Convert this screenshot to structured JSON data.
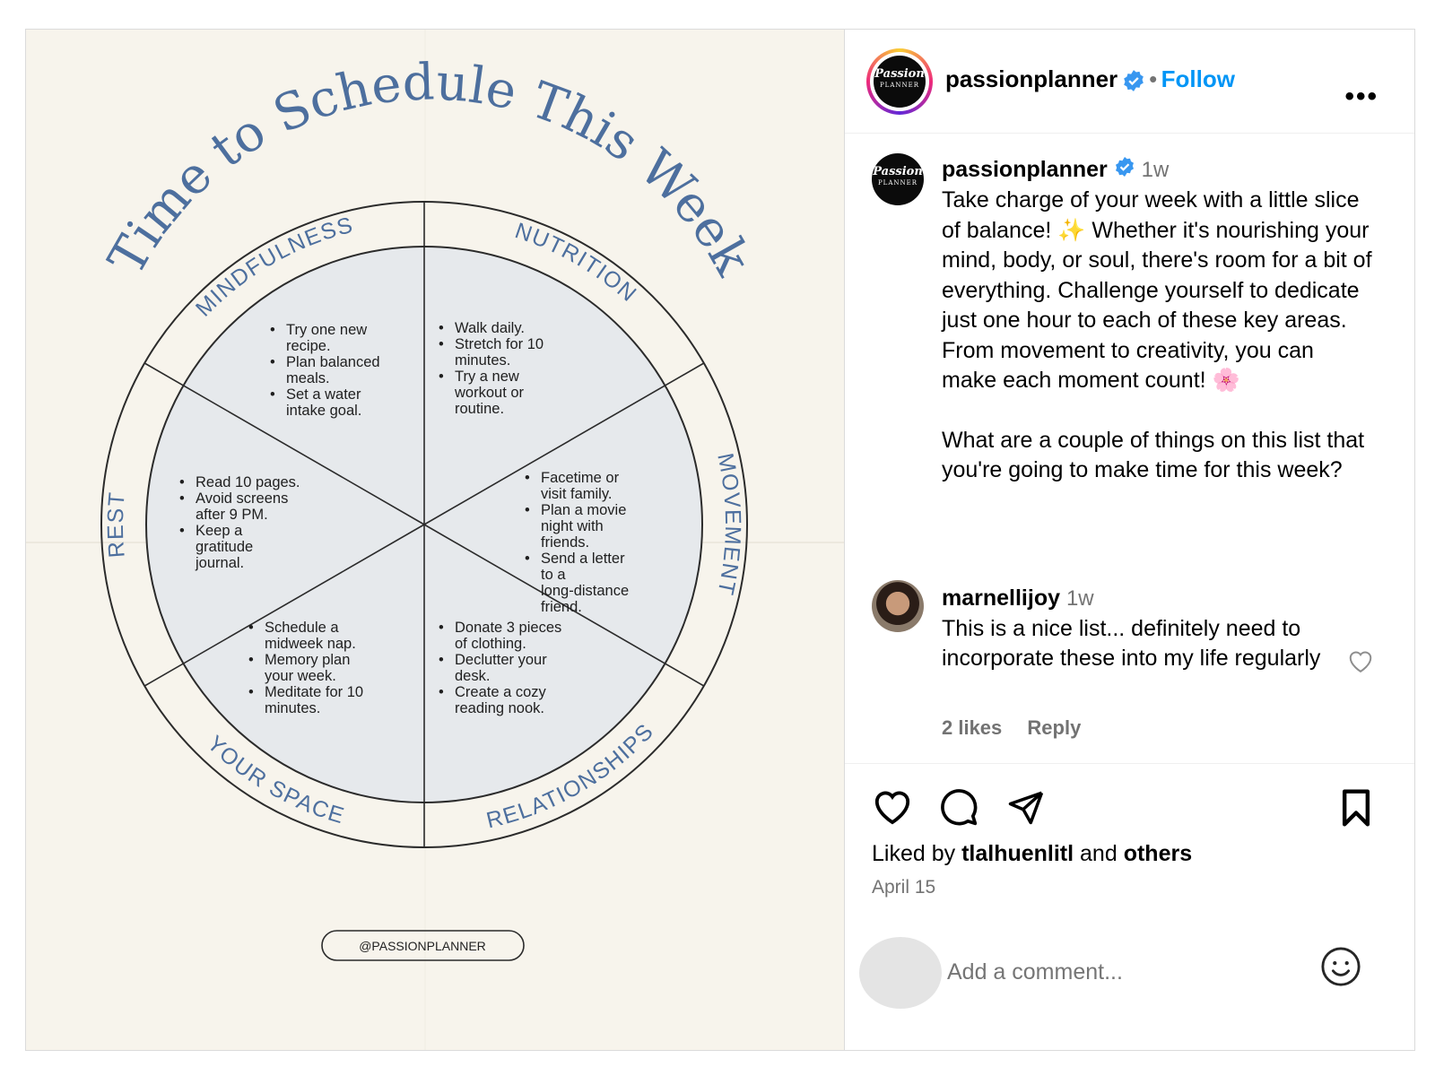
{
  "header": {
    "username": "passionplanner",
    "separator": "•",
    "follow_label": "Follow",
    "more_label": "•••",
    "avatar_logo": {
      "line1": "Passion",
      "line2": "PLANNER"
    }
  },
  "graphic": {
    "title": "Time to Schedule This Week",
    "segments": [
      {
        "label": "NUTRITION",
        "items": [
          "Try one new recipe.",
          "Plan balanced meals.",
          "Set a water intake goal."
        ]
      },
      {
        "label": "MOVEMENT",
        "items": [
          "Walk daily.",
          "Stretch for 10 minutes.",
          "Try a new workout or routine."
        ]
      },
      {
        "label": "RELATIONSHIPS",
        "items": [
          "Facetime or visit family.",
          "Plan a movie night with friends.",
          "Send a letter to a long-distance friend."
        ]
      },
      {
        "label": "YOUR SPACE",
        "items": [
          "Donate 3 pieces of clothing.",
          "Declutter your desk.",
          "Create a cozy reading nook."
        ]
      },
      {
        "label": "REST",
        "items": [
          "Schedule a midweek nap.",
          "Memory plan your week.",
          "Meditate for 10 minutes."
        ]
      },
      {
        "label": "MINDFULNESS",
        "items": [
          "Read 10 pages.",
          "Avoid screens after 9 PM.",
          "Keep a gratitude journal."
        ]
      }
    ],
    "handle": "@PASSIONPLANNER",
    "colors": {
      "accent": "#4d6f9e",
      "paper": "#f7f4ec",
      "wedge": "#e6e9ec"
    }
  },
  "caption": {
    "username": "passionplanner",
    "time": "1w",
    "text_p1a": "Take charge of your week with a little slice of balance!",
    "sparkle": "✨",
    "text_p1b": "Whether it's nourishing your mind, body, or soul, there's room for a bit of everything. Challenge yourself to dedicate just one hour to each of these key areas. From movement to creativity, you can make each moment count!",
    "flower": "🌸",
    "text_p2": "What are a couple of things on this list that you're going to make time for this week?"
  },
  "comment": {
    "username": "marnellijoy",
    "time": "1w",
    "text": "This is a nice list... definitely need to incorporate these into my life regularly",
    "likes": "2 likes",
    "reply_label": "Reply"
  },
  "actions": {
    "liked_prefix": "Liked by",
    "liked_user": "tlalhuenlitl",
    "liked_and": "and",
    "liked_others": "others",
    "date": "April 15"
  },
  "add_comment": {
    "placeholder": "Add a comment..."
  }
}
